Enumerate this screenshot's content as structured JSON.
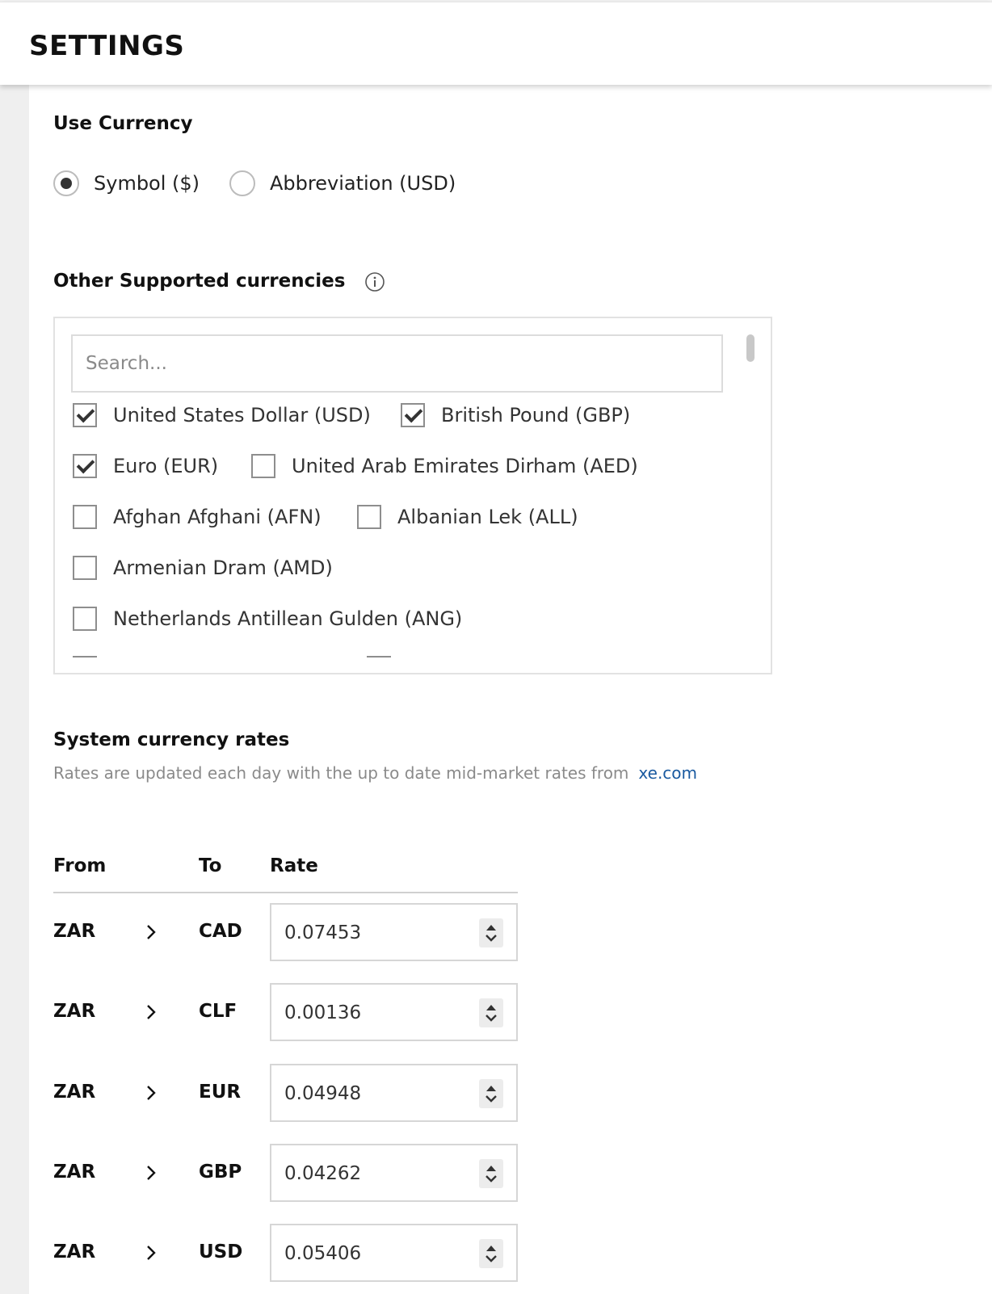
{
  "header": {
    "title": "SETTINGS"
  },
  "use_currency": {
    "title": "Use Currency",
    "options": [
      {
        "label": "Symbol ($)",
        "checked": true
      },
      {
        "label": "Abbreviation (USD)",
        "checked": false
      }
    ]
  },
  "other_currencies": {
    "title": "Other Supported currencies",
    "info_icon": "info-icon",
    "search_placeholder": "Search...",
    "items": [
      {
        "label": "United States Dollar (USD)",
        "checked": true
      },
      {
        "label": "British Pound (GBP)",
        "checked": true
      },
      {
        "label": "Euro (EUR)",
        "checked": true
      },
      {
        "label": "United Arab Emirates Dirham (AED)",
        "checked": false
      },
      {
        "label": "Afghan Afghani (AFN)",
        "checked": false
      },
      {
        "label": "Albanian Lek (ALL)",
        "checked": false
      },
      {
        "label": "Armenian Dram (AMD)",
        "checked": false
      },
      {
        "label": "Netherlands Antillean Gulden (ANG)",
        "checked": false
      }
    ]
  },
  "rates": {
    "title": "System currency rates",
    "description": "Rates are updated each day with the up to date mid-market rates from",
    "link": "xe.com",
    "columns": {
      "from": "From",
      "to": "To",
      "rate": "Rate"
    },
    "rows": [
      {
        "from": "ZAR",
        "to": "CAD",
        "rate": "0.07453"
      },
      {
        "from": "ZAR",
        "to": "CLF",
        "rate": "0.00136"
      },
      {
        "from": "ZAR",
        "to": "EUR",
        "rate": "0.04948"
      },
      {
        "from": "ZAR",
        "to": "GBP",
        "rate": "0.04262"
      },
      {
        "from": "ZAR",
        "to": "USD",
        "rate": "0.05406"
      }
    ]
  }
}
